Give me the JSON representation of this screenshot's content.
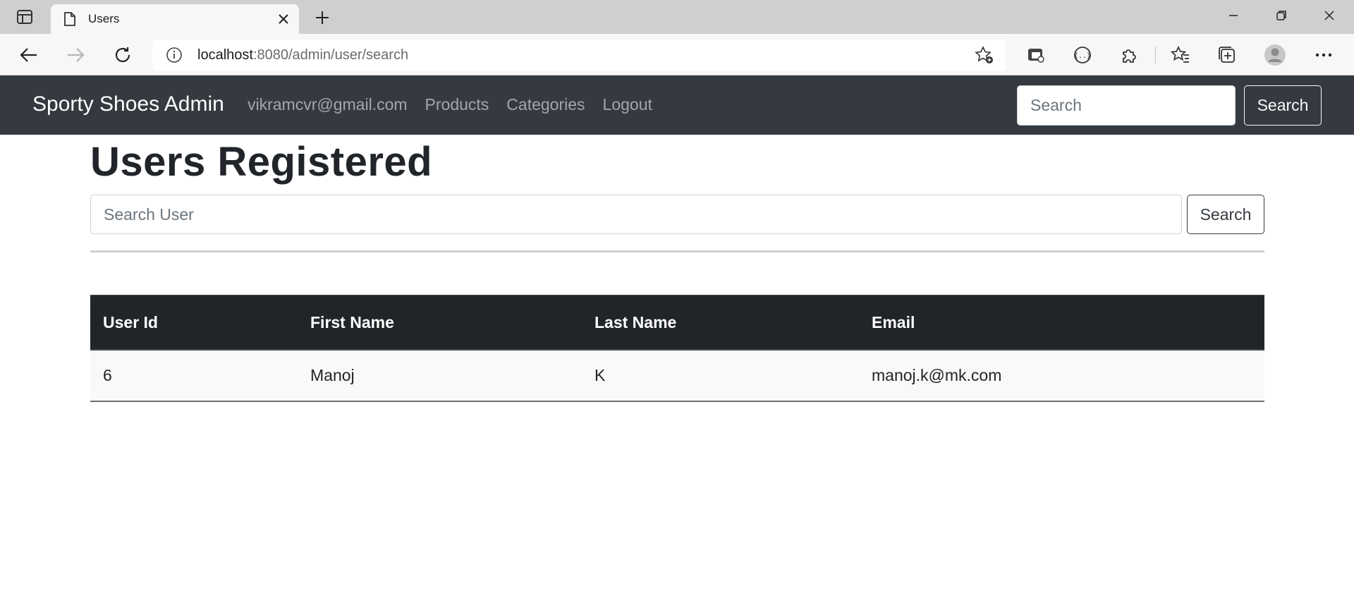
{
  "browser": {
    "tab_title": "Users",
    "url_host": "localhost",
    "url_path": ":8080/admin/user/search"
  },
  "navbar": {
    "brand": "Sporty Shoes Admin",
    "links": [
      "vikramcvr@gmail.com",
      "Products",
      "Categories",
      "Logout"
    ],
    "search_placeholder": "Search",
    "search_button": "Search"
  },
  "page": {
    "title": "Users Registered",
    "search_placeholder": "Search User",
    "search_button": "Search"
  },
  "table": {
    "headers": [
      "User Id",
      "First Name",
      "Last Name",
      "Email"
    ],
    "rows": [
      [
        "6",
        "Manoj",
        "K",
        "manoj.k@mk.com"
      ]
    ]
  },
  "colors": {
    "navbar_bg": "#343a40",
    "table_header_bg": "#212529"
  }
}
